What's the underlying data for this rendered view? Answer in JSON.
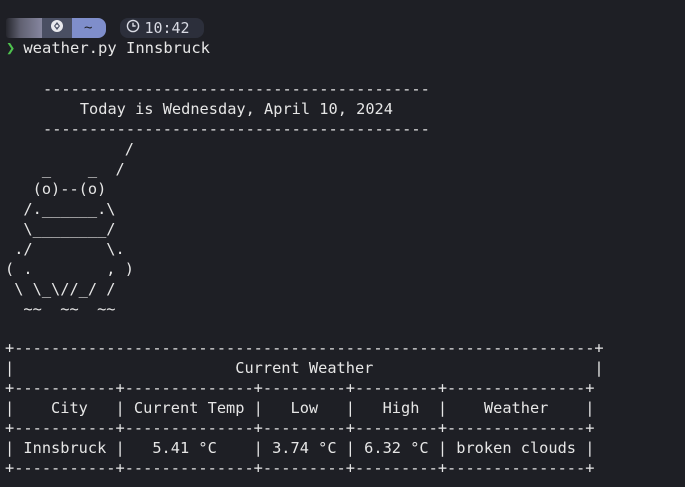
{
  "prompt": {
    "directory": "~",
    "time": "10:42",
    "command": "weather.py Innsbruck"
  },
  "banner": {
    "rule": "------------------------------------------",
    "date_line": "    Today is Wednesday, April 10, 2024"
  },
  "ascii_art": [
    "             /",
    "    _    _  /",
    "   (o)--(o)",
    "  /.______.\\",
    "  \\________/",
    " ./        \\.",
    "( .        , )",
    " \\ \\_\\//_/ /",
    "  ~~  ~~  ~~"
  ],
  "table": {
    "border_top": "+---------------------------------------------------------------+",
    "title_row": "|                        Current Weather                        |",
    "border_mid": "+-----------+--------------+---------+---------+---------------+",
    "header_row": "|    City   | Current Temp |   Low   |   High  |    Weather    |",
    "data_row": "| Innsbruck |   5.41 °C    | 3.74 °C | 6.32 °C | broken clouds |",
    "headers": [
      "City",
      "Current Temp",
      "Low",
      "High",
      "Weather"
    ],
    "rows": [
      [
        "Innsbruck",
        "5.41 °C",
        "3.74 °C",
        "6.32 °C",
        "broken clouds"
      ]
    ]
  },
  "colors": {
    "background": "#1e1f25",
    "prompt_chevron": "#4ec24e",
    "dir_segment": "#7f8ecb",
    "os_segment": "#4a4f63",
    "time_segment": "#2c2f3b"
  }
}
